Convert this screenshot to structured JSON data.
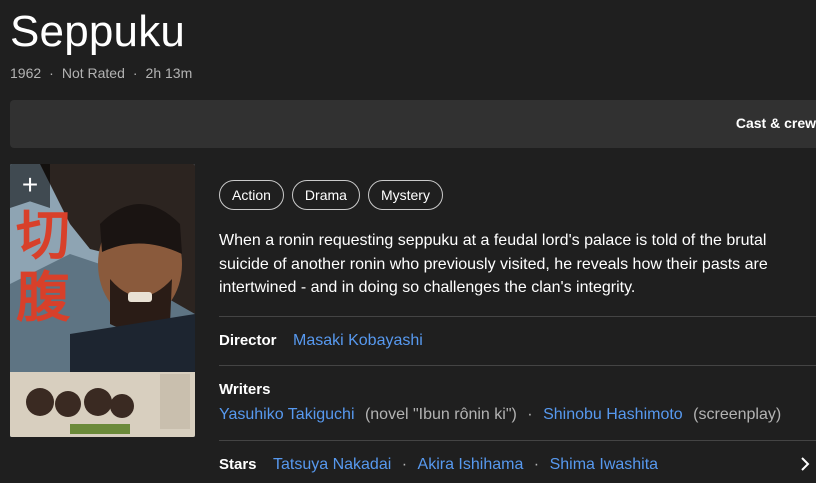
{
  "title": "Seppuku",
  "meta": {
    "year": "1962",
    "rating": "Not Rated",
    "runtime": "2h 13m",
    "separator": "·"
  },
  "tabbar": {
    "label": "Cast & crew"
  },
  "poster": {
    "add_symbol": "+",
    "poster_text": [
      "切",
      "腹"
    ],
    "add_icon": "plus-icon"
  },
  "genres": [
    "Action",
    "Drama",
    "Mystery"
  ],
  "plot": "When a ronin requesting seppuku at a feudal lord's palace is told of the brutal suicide of another ronin who previously visited, he reveals how their pasts are intertwined - and in doing so challenges the clan's integrity.",
  "director": {
    "label": "Director",
    "name": "Masaki Kobayashi"
  },
  "writers": {
    "label": "Writers",
    "items": [
      {
        "name": "Yasuhiko Takiguchi",
        "role": "(novel \"Ibun rônin ki\")"
      },
      {
        "name": "Shinobu Hashimoto",
        "role": "(screenplay)"
      }
    ]
  },
  "stars": {
    "label": "Stars",
    "names": [
      "Tatsuya Nakadai",
      "Akira Ishihama",
      "Shima Iwashita"
    ],
    "chevron_icon": "chevron-right-icon"
  },
  "colors": {
    "background": "#1f1f1f",
    "link": "#5799ef",
    "muted": "#b3b3b3",
    "tabbar": "#313131"
  }
}
